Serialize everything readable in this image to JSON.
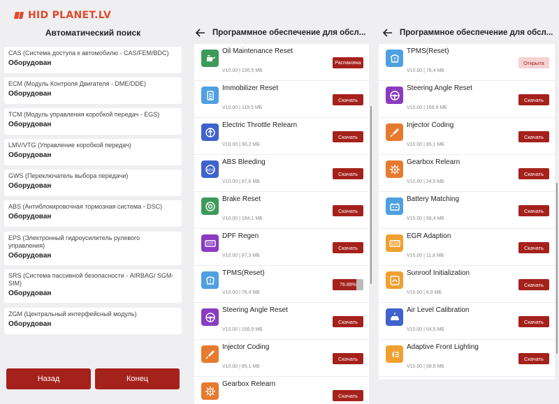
{
  "logo": {
    "text": "HID PLANET.LV"
  },
  "auto_search": {
    "title": "Автоматический поиск",
    "items": [
      {
        "name": "CAS (Система доступа к автомобилю - CAS/FEM/BDC)",
        "status": "Оборудован"
      },
      {
        "name": "ECM (Модуль Контроля Двигателя - DME/DDE)",
        "status": "Оборудован"
      },
      {
        "name": "TCM (Модуль управления коробкой передач - EGS)",
        "status": "Оборудован"
      },
      {
        "name": "LMV/VTG (Управление коробкой передач)",
        "status": "Оборудован"
      },
      {
        "name": "GWS (Переключатель выбора передачи)",
        "status": "Оборудован"
      },
      {
        "name": "ABS (Антиблокировочная тормозная система - DSC)",
        "status": "Оборудован"
      },
      {
        "name": "EPS (Электронный гидроусилитель рулевого управления)",
        "status": "Оборудован"
      },
      {
        "name": "SRS (Система пассивной безопасности - AIRBAG/ SGM-SIM)",
        "status": "Оборудован"
      },
      {
        "name": "ZGM (Центральный интерфейсный модуль)",
        "status": "Оборудован"
      }
    ],
    "back_label": "Назад",
    "end_label": "Конец"
  },
  "software_left": {
    "title": "Программное обеспечение для обсл...",
    "items": [
      {
        "name": "Oil Maintenance Reset",
        "version": "V10.00 | 100,5 МБ",
        "action": "Распаковка",
        "icon": "oil-can-icon",
        "color": "#3e9a5a"
      },
      {
        "name": "Immobilizer Reset",
        "version": "V10.00 | 119,5 МБ",
        "action": "Скачать",
        "icon": "immobilizer-icon",
        "color": "#4fa0e0"
      },
      {
        "name": "Electric Throttle Relearn",
        "version": "V10.00 | 90,2 МБ",
        "action": "Скачать",
        "icon": "throttle-icon",
        "color": "#3f62cc"
      },
      {
        "name": "ABS Bleeding",
        "version": "V10.00 | 87,6 МБ",
        "action": "Скачать",
        "icon": "abs-icon",
        "color": "#3f62cc"
      },
      {
        "name": "Brake Reset",
        "version": "V10.00 | 164,1 МБ",
        "action": "Скачать",
        "icon": "brake-icon",
        "color": "#3e9a5a"
      },
      {
        "name": "DPF Regen",
        "version": "V10.00 | 87,3 МБ",
        "action": "Скачать",
        "icon": "dpf-icon",
        "color": "#8a3cc0"
      },
      {
        "name": "TPMS(Reset)",
        "version": "V10.00 | 76,4 МБ",
        "action": "",
        "progress": 76.89,
        "progress_label": "76.89%",
        "icon": "tpms-icon",
        "color": "#4fa0e0"
      },
      {
        "name": "Steering Angle Reset",
        "version": "V10.00 | 166,9 МБ",
        "action": "Скачать",
        "icon": "steering-icon",
        "color": "#8a3cc0"
      },
      {
        "name": "Injector Coding",
        "version": "V10.00 | 85,1 МБ",
        "action": "Скачать",
        "icon": "injector-icon",
        "color": "#e67a2e"
      },
      {
        "name": "Gearbox Relearn",
        "version": "",
        "action": "Скачать",
        "icon": "gear-icon",
        "color": "#e67a2e"
      }
    ]
  },
  "software_right": {
    "title": "Программное обеспечение для обсл...",
    "items": [
      {
        "name": "TPMS(Reset)",
        "version": "V10.00 | 76,4 МБ",
        "action": "Открыта",
        "icon": "tpms-icon",
        "color": "#4fa0e0"
      },
      {
        "name": "Steering Angle Reset",
        "version": "V10.00 | 166,9 МБ",
        "action": "Скачать",
        "icon": "steering-icon",
        "color": "#8a3cc0"
      },
      {
        "name": "Injector Coding",
        "version": "V10.00 | 85,1 МБ",
        "action": "Скачать",
        "icon": "injector-icon",
        "color": "#e67a2e"
      },
      {
        "name": "Gearbox Relearn",
        "version": "V10.00 | 24,5 МБ",
        "action": "Скачать",
        "icon": "gear-icon",
        "color": "#e67a2e"
      },
      {
        "name": "Battery Matching",
        "version": "V10.00 | 68,4 МБ",
        "action": "Скачать",
        "icon": "battery-icon",
        "color": "#4fa0e0"
      },
      {
        "name": "EGR Adaption",
        "version": "V10.00 | 11,8 МБ",
        "action": "Скачать",
        "icon": "egr-icon",
        "color": "#f0a030"
      },
      {
        "name": "Sunroof Initialization",
        "version": "V10.00 | 8,9 МБ",
        "action": "Скачать",
        "icon": "sunroof-icon",
        "color": "#f0a030"
      },
      {
        "name": "Air Level Calibration",
        "version": "V10.00 | 64,5 МБ",
        "action": "Скачать",
        "icon": "air-level-icon",
        "color": "#3f62cc"
      },
      {
        "name": "Adaptive Front Lighting",
        "version": "V10.00 | 58,6 МБ",
        "action": "Скачать",
        "icon": "headlight-icon",
        "color": "#f0a030"
      }
    ]
  }
}
